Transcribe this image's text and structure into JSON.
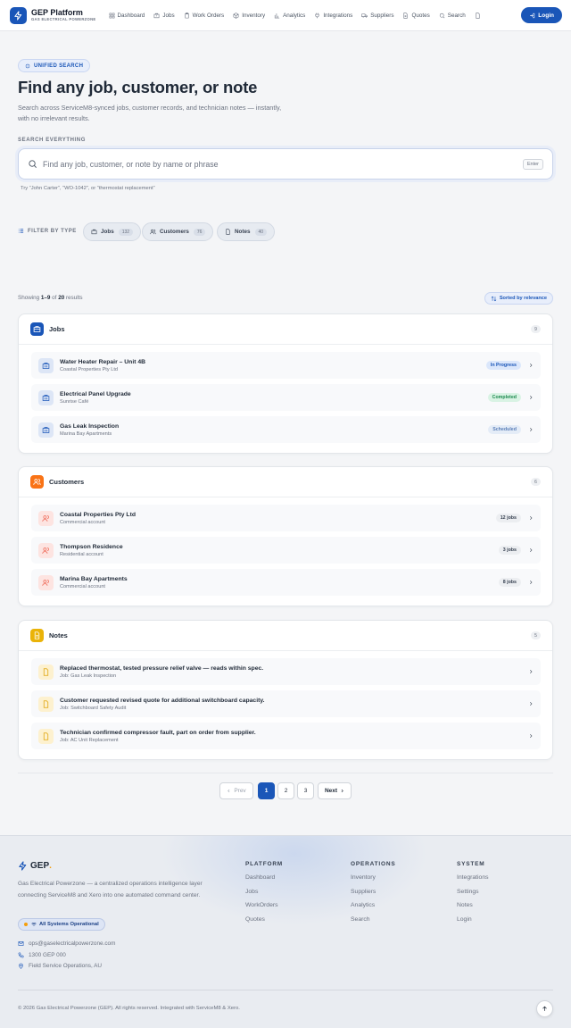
{
  "header": {
    "brand_title": "GEP Platform",
    "brand_sub": "GAS ELECTRICAL POWERZONE",
    "nav": [
      {
        "label": "Dashboard",
        "icon": "grid-icon"
      },
      {
        "label": "Jobs",
        "icon": "briefcase-icon"
      },
      {
        "label": "Work Orders",
        "icon": "clipboard-icon"
      },
      {
        "label": "Inventory",
        "icon": "box-icon"
      },
      {
        "label": "Analytics",
        "icon": "bar-chart-icon"
      },
      {
        "label": "Integrations",
        "icon": "plug-icon"
      },
      {
        "label": "Suppliers",
        "icon": "truck-icon"
      },
      {
        "label": "Quotes",
        "icon": "document-icon"
      },
      {
        "label": "Search",
        "icon": "search-icon"
      }
    ],
    "login_label": "Login"
  },
  "hero": {
    "chip": "UNIFIED SEARCH",
    "title": "Find any job, customer, or note",
    "subtitle": "Search across ServiceM8-synced jobs, customer records, and technician notes — instantly, with no irrelevant results."
  },
  "search": {
    "label": "SEARCH EVERYTHING",
    "placeholder": "Find any job, customer, or note by name or phrase",
    "enter_key": "Enter",
    "hint": "Try “John Carter”, “WO-1042”, or “thermostat replacement”"
  },
  "filters": {
    "label": "FILTER BY TYPE",
    "pills": [
      {
        "label": "Jobs",
        "count": "132"
      },
      {
        "label": "Customers",
        "count": "76"
      },
      {
        "label": "Notes",
        "count": "40"
      }
    ]
  },
  "results": {
    "showing_prefix": "Showing",
    "range": "1–9",
    "of": "of",
    "total": "20",
    "suffix": "results",
    "sort_label": "Sorted by relevance"
  },
  "groups": [
    {
      "title": "Jobs",
      "count": "9",
      "color": "#1a56b8",
      "items": [
        {
          "title": "Water Heater Repair – Unit 4B",
          "sub": "Coastal Properties Pty Ltd",
          "badge": "In Progress"
        },
        {
          "title": "Electrical Panel Upgrade",
          "sub": "Sunrise Café",
          "badge": "Completed"
        },
        {
          "title": "Gas Leak Inspection",
          "sub": "Marina Bay Apartments",
          "badge": "Scheduled"
        }
      ]
    },
    {
      "title": "Customers",
      "count": "6",
      "color": "#f97316",
      "items": [
        {
          "title": "Coastal Properties Pty Ltd",
          "sub": "Commercial account",
          "badge": "12 jobs"
        },
        {
          "title": "Thompson Residence",
          "sub": "Residential account",
          "badge": "3 jobs"
        },
        {
          "title": "Marina Bay Apartments",
          "sub": "Commercial account",
          "badge": "8 jobs"
        }
      ]
    },
    {
      "title": "Notes",
      "count": "5",
      "color": "#eab308",
      "items": [
        {
          "title": "Replaced thermostat, tested pressure relief valve — reads within spec.",
          "sub": "Job: Gas Leak Inspection",
          "badge": ""
        },
        {
          "title": "Customer requested revised quote for additional switchboard capacity.",
          "sub": "Job: Switchboard Safety Audit",
          "badge": ""
        },
        {
          "title": "Technician confirmed compressor fault, part on order from supplier.",
          "sub": "Job: AC Unit Replacement",
          "badge": ""
        }
      ]
    }
  ],
  "pagination": {
    "prev": "Prev",
    "pages": [
      "1",
      "2",
      "3"
    ],
    "current": "1",
    "next": "Next"
  },
  "footer": {
    "logo": "GEP",
    "logo_dot": ".",
    "description": "Gas Electrical Powerzone — a centralized operations intelligence layer connecting ServiceM8 and Xero into one automated command center.",
    "status": "All Systems Operational",
    "email": "ops@gaselectricalpowerzone.com",
    "phone": "1300 GEP 000",
    "location": "Field Service Operations, AU",
    "columns": [
      {
        "title": "PLATFORM",
        "links": [
          "Dashboard",
          "Jobs",
          "WorkOrders",
          "Quotes"
        ]
      },
      {
        "title": "OPERATIONS",
        "links": [
          "Inventory",
          "Suppliers",
          "Analytics",
          "Search"
        ]
      },
      {
        "title": "SYSTEM",
        "links": [
          "Integrations",
          "Settings",
          "Notes",
          "Login"
        ]
      }
    ],
    "copyright": "© 2026 Gas Electrical Powerzone (GEP). All rights reserved. Integrated with ServiceM8 & Xero."
  },
  "colors": {
    "accent": "#1a56b8",
    "in_progress_bg": "#dbe7fb",
    "in_progress_fg": "#1a56b8",
    "completed_bg": "#d9f3e4",
    "completed_fg": "#1d8a4f",
    "scheduled_bg": "#e4ecf7",
    "scheduled_fg": "#5b7fb8"
  }
}
